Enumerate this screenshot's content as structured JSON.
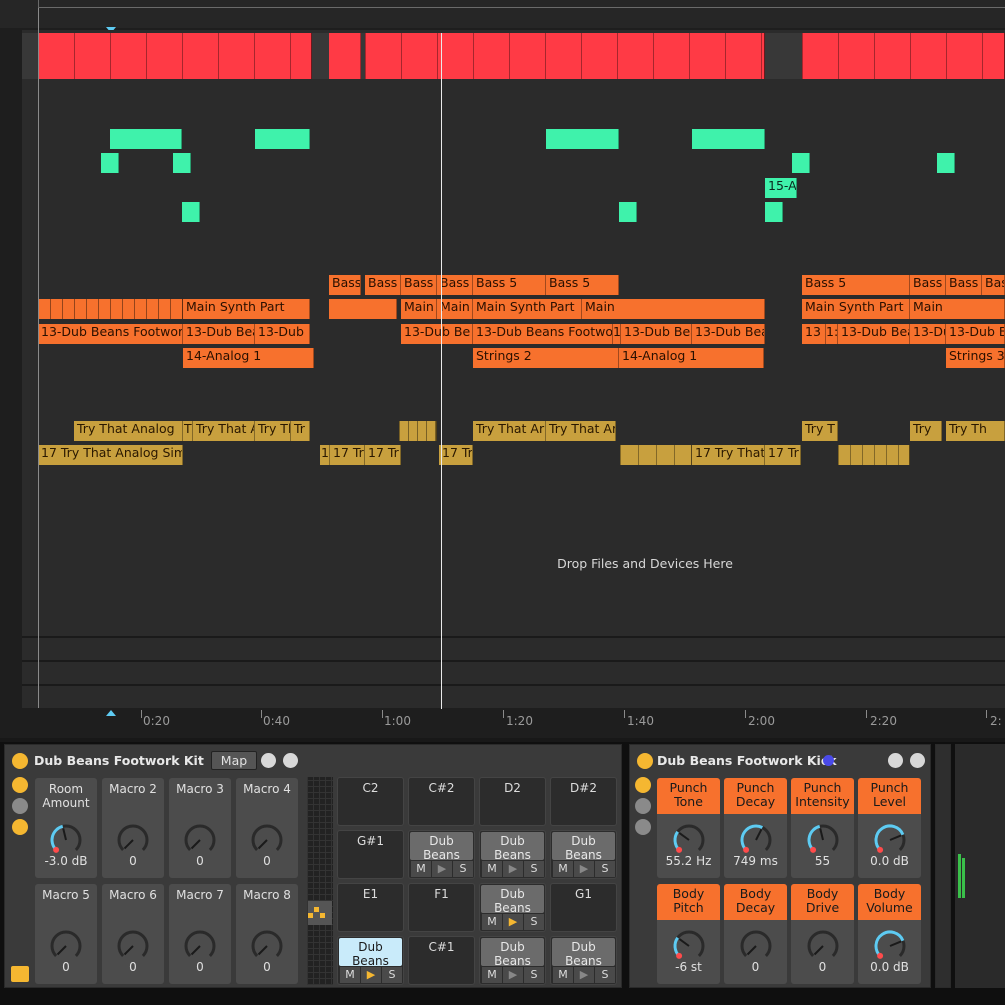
{
  "arrangement": {
    "drop_hint": "Drop Files and Devices Here",
    "timeline": [
      "0:20",
      "0:40",
      "1:00",
      "1:20",
      "1:40",
      "2:00",
      "2:20",
      "2:"
    ],
    "clips": {
      "bass_labels": [
        "Bass",
        "Bass",
        "Bass 4",
        "Bass",
        "Bass 5",
        "Bass 5",
        "Bass 5",
        "Bass 5",
        "Bass",
        "Bas"
      ],
      "mainsynth_labels": [
        "Main Synth Part",
        "Main",
        "Main",
        "Main Synth Part",
        "Main",
        "Main Synth Part",
        "Main"
      ],
      "dubbeans_labels": [
        "13-Dub Beans Footwor",
        "13-Dub Bea",
        "13-Dub Bea",
        "13-Dub Be",
        "13-Dub Beans Footwo",
        "1",
        "13-Dub Bea",
        "13-Dub Bea",
        "13",
        "1:",
        "13-Dub Bea",
        "13-Du",
        "13-Dub Be"
      ],
      "analog_labels": [
        "14-Analog 1",
        "Strings 2",
        "14-Analog 1",
        "Strings 3"
      ],
      "try_labels": [
        "Try That Analog",
        "T",
        "Try That A",
        "Try Th",
        "Tr",
        "Try That Ar",
        "Try That Ar",
        "Try T",
        "Try",
        "Try Th"
      ],
      "t17_labels": [
        "17 Try That Analog Sim",
        "1",
        "17 Tr",
        "17 Tr",
        "17 Tr",
        "17 Try That",
        "17 Tr"
      ],
      "mint_label": "15-A"
    }
  },
  "device1": {
    "title": "Dub Beans Footwork Kit",
    "map_button": "Map",
    "macros": [
      {
        "name": "Room Amount",
        "value": "-3.0 dB",
        "level": 0.45
      },
      {
        "name": "Macro 2",
        "value": "0",
        "level": 0
      },
      {
        "name": "Macro 3",
        "value": "0",
        "level": 0
      },
      {
        "name": "Macro 4",
        "value": "0",
        "level": 0
      },
      {
        "name": "Macro 5",
        "value": "0",
        "level": 0
      },
      {
        "name": "Macro 6",
        "value": "0",
        "level": 0
      },
      {
        "name": "Macro 7",
        "value": "0",
        "level": 0
      },
      {
        "name": "Macro 8",
        "value": "0",
        "level": 0
      }
    ],
    "pads": [
      {
        "label": "C2"
      },
      {
        "label": "C#2"
      },
      {
        "label": "D2"
      },
      {
        "label": "D#2"
      },
      {
        "label": "G#1"
      },
      {
        "label": "Dub Beans"
      },
      {
        "label": "Dub Beans"
      },
      {
        "label": "Dub Beans"
      },
      {
        "label": "E1"
      },
      {
        "label": "F1"
      },
      {
        "label": "Dub Beans"
      },
      {
        "label": "G1"
      },
      {
        "label": "Dub Beans"
      },
      {
        "label": "C#1"
      },
      {
        "label": "Dub Beans"
      },
      {
        "label": "Dub Beans"
      }
    ],
    "pad_buttons": {
      "mute": "M",
      "play": "▶",
      "solo": "S"
    }
  },
  "device2": {
    "title": "Dub Beans Footwork Kick",
    "params": [
      {
        "name": "Punch Tone",
        "value": "55.2 Hz",
        "level": 0.3
      },
      {
        "name": "Punch Decay",
        "value": "749 ms",
        "level": 0.6
      },
      {
        "name": "Punch Intensity",
        "value": "55",
        "level": 0.45
      },
      {
        "name": "Punch Level",
        "value": "0.0 dB",
        "level": 0.75
      },
      {
        "name": "Body Pitch",
        "value": "-6 st",
        "level": 0.3
      },
      {
        "name": "Body Decay",
        "value": "0",
        "level": 0
      },
      {
        "name": "Body Drive",
        "value": "0",
        "level": 0
      },
      {
        "name": "Body Volume",
        "value": "0.0 dB",
        "level": 0.75
      }
    ]
  },
  "colors": {
    "accent": "#f7712d",
    "mint": "#3ff2ab",
    "red": "#ff3a45",
    "gold": "#c8a03e",
    "knob": "#5ecbf2"
  }
}
